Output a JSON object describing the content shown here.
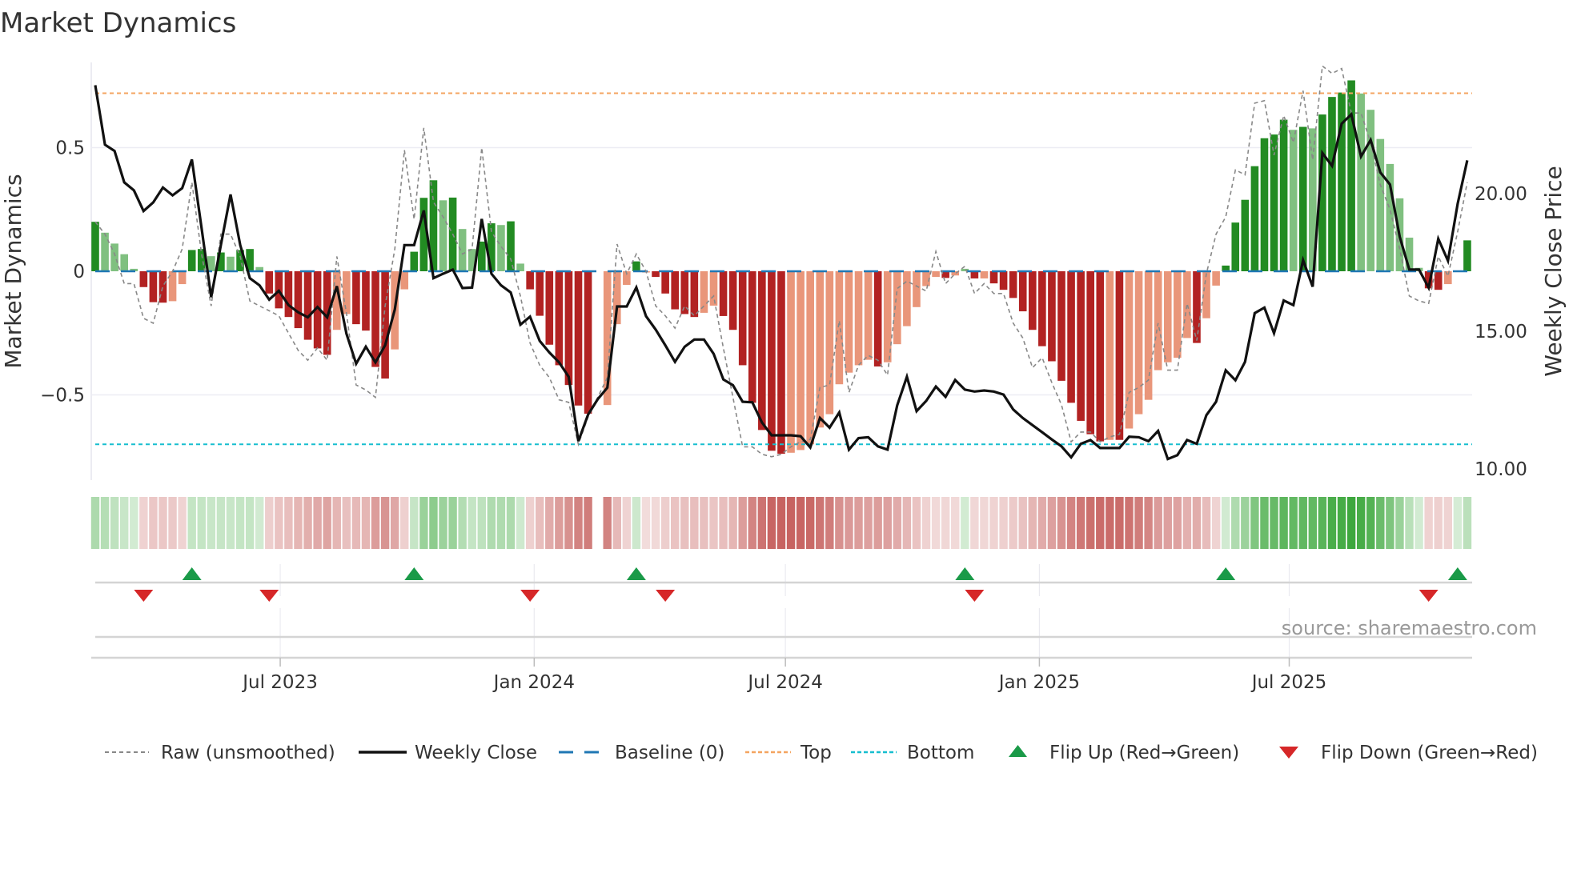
{
  "title": "Market Dynamics",
  "source": "source: sharemaestro.com",
  "colors": {
    "bar_dark_green": "#228b22",
    "bar_light_green": "#80c080",
    "bar_dark_red": "#b22222",
    "bar_light_red": "#e9967a",
    "close_line": "#111111",
    "raw_line": "#888888",
    "baseline": "#1f77b4",
    "top": "#f4a460",
    "bottom": "#17becf",
    "flip_up": "#1a9a48",
    "flip_down": "#d62728",
    "heat_green": "#2ca02c",
    "heat_red": "#c0504d"
  },
  "chart_data": {
    "type": "bar+line",
    "title": "Market Dynamics",
    "ylabel": "Market Dynamics",
    "y2label": "Weekly Close Price",
    "ylim": [
      -0.85,
      0.85
    ],
    "y2lim": [
      10,
      25
    ],
    "yticks": [
      {
        "v": 0.5,
        "label": "0.5"
      },
      {
        "v": 0,
        "label": "0"
      },
      {
        "v": -0.5,
        "label": "−0.5"
      }
    ],
    "y2ticks": [
      {
        "v": 20,
        "label": "20.00"
      },
      {
        "v": 15,
        "label": "15.00"
      },
      {
        "v": 10,
        "label": "10.00"
      }
    ],
    "xticks": [
      {
        "date": "2023-07-01",
        "label": "Jul 2023"
      },
      {
        "date": "2024-01-01",
        "label": "Jan 2024"
      },
      {
        "date": "2024-07-01",
        "label": "Jul 2024"
      },
      {
        "date": "2025-01-01",
        "label": "Jan 2025"
      },
      {
        "date": "2025-07-01",
        "label": "Jul 2025"
      }
    ],
    "start_date": "2023-02-17",
    "interval_days": 7,
    "top_level": 0.72,
    "bottom_level": -0.7,
    "baseline": 0,
    "dynamics": [
      0.2,
      0.156,
      0.112,
      0.069,
      0.01,
      -0.064,
      -0.125,
      -0.127,
      -0.121,
      -0.052,
      0.086,
      0.09,
      0.061,
      0.076,
      0.059,
      0.086,
      0.09,
      0.017,
      -0.09,
      -0.15,
      -0.185,
      -0.23,
      -0.277,
      -0.312,
      -0.338,
      -0.237,
      -0.173,
      -0.214,
      -0.24,
      -0.387,
      -0.434,
      -0.316,
      -0.073,
      0.079,
      0.297,
      0.368,
      0.287,
      0.298,
      0.171,
      0.09,
      0.12,
      0.194,
      0.187,
      0.202,
      0.031,
      -0.073,
      -0.18,
      -0.297,
      -0.38,
      -0.46,
      -0.543,
      -0.576,
      null,
      -0.541,
      -0.214,
      -0.055,
      0.04,
      -0.005,
      -0.023,
      -0.09,
      -0.154,
      -0.173,
      -0.185,
      -0.168,
      -0.139,
      -0.181,
      -0.237,
      -0.38,
      -0.532,
      -0.642,
      -0.726,
      -0.738,
      -0.734,
      -0.723,
      -0.7,
      -0.632,
      -0.578,
      -0.457,
      -0.41,
      -0.38,
      -0.358,
      -0.385,
      -0.368,
      -0.295,
      -0.222,
      -0.145,
      -0.06,
      -0.023,
      -0.027,
      -0.017,
      0.01,
      -0.029,
      -0.029,
      -0.049,
      -0.075,
      -0.108,
      -0.162,
      -0.237,
      -0.303,
      -0.364,
      -0.443,
      -0.532,
      -0.605,
      -0.659,
      -0.688,
      -0.682,
      -0.682,
      -0.636,
      -0.578,
      -0.52,
      -0.4,
      -0.368,
      -0.35,
      -0.27,
      -0.29,
      -0.19,
      -0.058,
      0.023,
      0.197,
      0.289,
      0.425,
      0.538,
      0.553,
      0.613,
      0.572,
      0.584,
      0.578,
      0.634,
      0.705,
      0.723,
      0.772,
      0.719,
      0.653,
      0.535,
      0.434,
      0.295,
      0.136,
      0.014,
      -0.069,
      -0.075,
      -0.052,
      0.002,
      0.125
    ],
    "bar_shade": "dllllddddldd ldld dl",
    "bar_tone": [
      "dark",
      "light",
      "light",
      "light",
      "light",
      "dark",
      "dark",
      "dark",
      "light",
      "light",
      "dark",
      "dark",
      "light",
      "dark",
      "light",
      "dark",
      "dark",
      "light",
      "dark",
      "dark",
      "dark",
      "dark",
      "dark",
      "dark",
      "dark",
      "light",
      "light",
      "dark",
      "dark",
      "dark",
      "dark",
      "light",
      "light",
      "dark",
      "dark",
      "dark",
      "light",
      "dark",
      "light",
      "light",
      "dark",
      "dark",
      "light",
      "dark",
      "light",
      "dark",
      "dark",
      "dark",
      "dark",
      "dark",
      "dark",
      "dark",
      null,
      "light",
      "light",
      "light",
      "dark",
      "light",
      "dark",
      "dark",
      "dark",
      "dark",
      "dark",
      "light",
      "light",
      "dark",
      "dark",
      "dark",
      "dark",
      "dark",
      "dark",
      "dark",
      "light",
      "light",
      "light",
      "light",
      "light",
      "light",
      "light",
      "light",
      "light",
      "dark",
      "light",
      "light",
      "light",
      "light",
      "light",
      "light",
      "dark",
      "light",
      "light",
      "dark",
      "light",
      "dark",
      "dark",
      "dark",
      "dark",
      "dark",
      "dark",
      "dark",
      "dark",
      "dark",
      "dark",
      "dark",
      "dark",
      "light",
      "dark",
      "light",
      "light",
      "light",
      "light",
      "light",
      "light",
      "light",
      "dark",
      "light",
      "light",
      "dark",
      "dark",
      "dark",
      "dark",
      "dark",
      "dark",
      "dark",
      "light",
      "dark",
      "light",
      "dark",
      "dark",
      "dark",
      "dark",
      "light",
      "light",
      "light",
      "light",
      "light",
      "light",
      "light",
      "dark",
      "dark",
      "light",
      "light",
      "dark"
    ],
    "raw": [
      0.2,
      0.15,
      0.07,
      -0.05,
      -0.05,
      -0.19,
      -0.21,
      -0.06,
      0,
      0.09,
      0.36,
      0.07,
      -0.14,
      0.15,
      0.15,
      0.06,
      -0.12,
      -0.14,
      -0.16,
      -0.18,
      -0.25,
      -0.32,
      -0.36,
      -0.31,
      -0.36,
      0.06,
      -0.17,
      -0.46,
      -0.48,
      -0.51,
      -0.14,
      0.09,
      0.49,
      0.21,
      0.58,
      0.28,
      0.22,
      0.15,
      0.07,
      0.09,
      0.5,
      0.16,
      0.1,
      0.05,
      -0.1,
      -0.29,
      -0.38,
      -0.43,
      -0.52,
      -0.53,
      -0.7,
      -0.59,
      null,
      -0.43,
      0.11,
      -0.01,
      0.07,
      0,
      -0.14,
      -0.18,
      -0.23,
      -0.14,
      -0.18,
      -0.14,
      -0.1,
      -0.31,
      -0.51,
      -0.71,
      -0.71,
      -0.74,
      -0.75,
      -0.74,
      -0.71,
      -0.69,
      -0.68,
      -0.47,
      -0.46,
      -0.2,
      -0.49,
      -0.38,
      -0.34,
      -0.36,
      -0.42,
      -0.07,
      -0.04,
      -0.06,
      -0.08,
      0.08,
      -0.05,
      -0.01,
      0.02,
      -0.09,
      -0.05,
      -0.09,
      -0.09,
      -0.21,
      -0.27,
      -0.39,
      -0.35,
      -0.45,
      -0.54,
      -0.69,
      -0.65,
      -0.65,
      -0.69,
      -0.67,
      -0.66,
      -0.49,
      -0.47,
      -0.44,
      -0.21,
      -0.4,
      -0.4,
      -0.13,
      -0.28,
      -0.01,
      0.15,
      0.22,
      0.41,
      0.39,
      0.68,
      0.69,
      0.47,
      0.63,
      0.52,
      0.73,
      0.45,
      0.83,
      0.8,
      0.82,
      0.64,
      0.64,
      0.52,
      0.35,
      0.25,
      0.09,
      -0.1,
      -0.12,
      -0.13,
      0.06,
      -0.02,
      0.16,
      0.36
    ],
    "close": [
      23.94,
      21.78,
      21.55,
      20.41,
      20.12,
      19.37,
      19.68,
      20.22,
      19.94,
      20.2,
      21.24,
      18.75,
      16.24,
      18.13,
      19.97,
      18.13,
      16.93,
      16.67,
      16.15,
      16.47,
      15.95,
      15.69,
      15.51,
      15.88,
      15.51,
      16.64,
      14.91,
      13.82,
      14.44,
      13.87,
      14.49,
      15.79,
      18.13,
      18.13,
      19.39,
      16.93,
      17.09,
      17.24,
      16.57,
      16.59,
      19.08,
      17.09,
      16.67,
      16.41,
      15.24,
      15.53,
      14.65,
      14.23,
      13.87,
      13.35,
      11.01,
      11.97,
      12.53,
      12.95,
      15.9,
      15.9,
      16.59,
      15.55,
      15.06,
      14.49,
      13.89,
      14.44,
      14.7,
      14.7,
      14.18,
      13.25,
      13.04,
      12.44,
      12.42,
      11.69,
      11.22,
      11.22,
      11.22,
      11.19,
      10.78,
      11.85,
      11.5,
      12.05,
      10.7,
      11.12,
      11.15,
      10.82,
      10.7,
      12.31,
      13.35,
      12.1,
      12.47,
      12.99,
      12.62,
      13.23,
      12.88,
      12.81,
      12.85,
      12.81,
      12.7,
      12.16,
      11.85,
      11.59,
      11.33,
      11.07,
      10.82,
      10.42,
      10.91,
      11.05,
      10.76,
      10.76,
      10.76,
      11.17,
      11.15,
      11.01,
      11.38,
      10.36,
      10.5,
      11.05,
      10.91,
      11.95,
      12.44,
      13.58,
      13.22,
      13.89,
      15.66,
      15.86,
      14.93,
      16.12,
      15.95,
      17.58,
      16.62,
      21.48,
      21.01,
      22.54,
      22.88,
      21.35,
      21.95,
      20.77,
      20.33,
      18.44,
      17.24,
      17.24,
      16.58,
      18.36,
      17.56,
      19.63,
      21.21
    ],
    "flip_up": [
      "2023-04-28",
      "2023-10-06",
      "2024-03-15",
      "2024-11-08",
      "2025-05-16",
      "2025-10-31"
    ],
    "flip_down": [
      "2023-03-24",
      "2023-06-23",
      "2023-12-29",
      "2024-04-05",
      "2024-11-15",
      "2025-10-10"
    ]
  },
  "legend": [
    {
      "key": "raw",
      "label": "Raw (unsmoothed)"
    },
    {
      "key": "close",
      "label": "Weekly Close"
    },
    {
      "key": "baseline",
      "label": "Baseline (0)"
    },
    {
      "key": "top",
      "label": "Top"
    },
    {
      "key": "bottom",
      "label": "Bottom"
    },
    {
      "key": "flip_up",
      "label": "Flip Up (Red→Green)"
    },
    {
      "key": "flip_down",
      "label": "Flip Down (Green→Red)"
    }
  ]
}
